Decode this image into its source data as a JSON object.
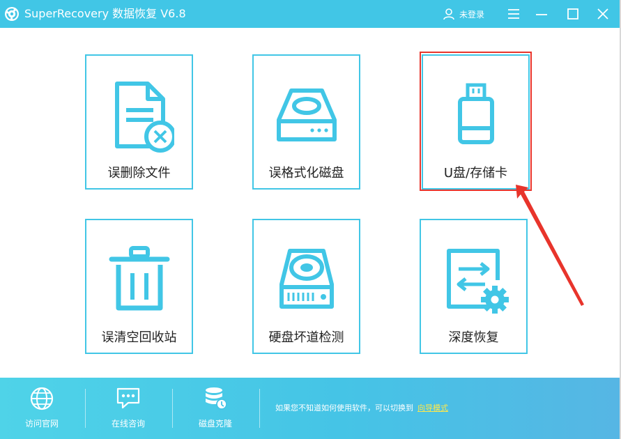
{
  "titlebar": {
    "title": "SuperRecovery 数据恢复 V6.8",
    "user_label": "未登录",
    "icons": [
      "user-icon",
      "menu-icon",
      "minimize-icon",
      "maximize-icon",
      "close-icon"
    ]
  },
  "tiles": [
    {
      "label": "误删除文件",
      "icon": "deleted-file-icon"
    },
    {
      "label": "误格式化磁盘",
      "icon": "disk-icon"
    },
    {
      "label": "U盘/存储卡",
      "icon": "usb-drive-icon"
    },
    {
      "label": "误清空回收站",
      "icon": "trash-icon"
    },
    {
      "label": "硬盘坏道检测",
      "icon": "hard-drive-icon"
    },
    {
      "label": "深度恢复",
      "icon": "deep-recovery-icon"
    }
  ],
  "footer": {
    "items": [
      {
        "label": "访问官网",
        "icon": "globe-icon"
      },
      {
        "label": "在线咨询",
        "icon": "chat-icon"
      },
      {
        "label": "磁盘克隆",
        "icon": "database-clone-icon"
      }
    ],
    "hint": "如果您不知道如何使用软件，可以切换到",
    "guide_link": "向导模式"
  },
  "colors": {
    "accent": "#41c6e6",
    "highlight": "#e8342b",
    "link": "#ffe84a"
  }
}
